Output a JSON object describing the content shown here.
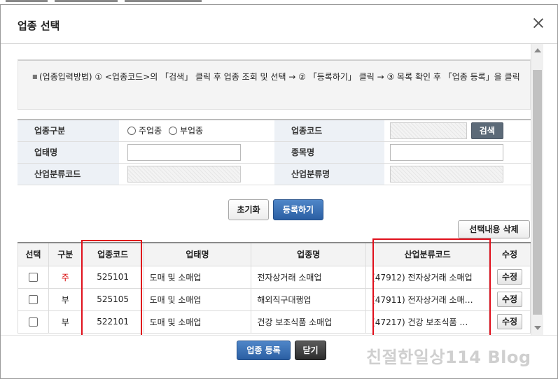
{
  "dialog": {
    "title": "업종 선택"
  },
  "guide": {
    "text": "(업종입력방법) ① <업종코드>의 「검색」 클릭 후 업종 조회 및 선택 → ② 「등록하기」 클릭 → ③ 목록 확인 후 「업종 등록」을 클릭"
  },
  "form": {
    "type_label": "업종구분",
    "radio_main": "주업종",
    "radio_sub": "부업종",
    "code_label": "업종코드",
    "search_button": "검색",
    "business_label": "업태명",
    "item_label": "종목명",
    "industry_code_label": "산업분류코드",
    "industry_name_label": "산업분류명"
  },
  "actions": {
    "reset": "초기화",
    "register": "등록하기",
    "delete_selected": "선택내용 삭제"
  },
  "table": {
    "headers": [
      "선택",
      "구분",
      "업종코드",
      "업태명",
      "업종명",
      "산업분류코드",
      "수정"
    ],
    "rows": [
      {
        "type": "주",
        "code": "525101",
        "business": "도매 및 소매업",
        "name": "전자상거래 소매업",
        "industry": "(47912) 전자상거래 소매업",
        "edit": "수정"
      },
      {
        "type": "부",
        "code": "525105",
        "business": "도매 및 소매업",
        "name": "해외직구대행업",
        "industry": "(47911) 전자상거래 소매…",
        "edit": "수정"
      },
      {
        "type": "부",
        "code": "522101",
        "business": "도매 및 소매업",
        "name": "건강 보조식품 소매업",
        "industry": "(47217) 건강 보조식품 …",
        "edit": "수정"
      }
    ]
  },
  "footer": {
    "register_button": "업종 등록",
    "close_button": "닫기"
  },
  "watermark": "친절한일상114 Blog",
  "colors": {
    "label_bg": "#edf1f6",
    "accent_blue": "#2b5fa3",
    "highlight_red": "#e0101c",
    "main_type_red": "#d80000"
  }
}
